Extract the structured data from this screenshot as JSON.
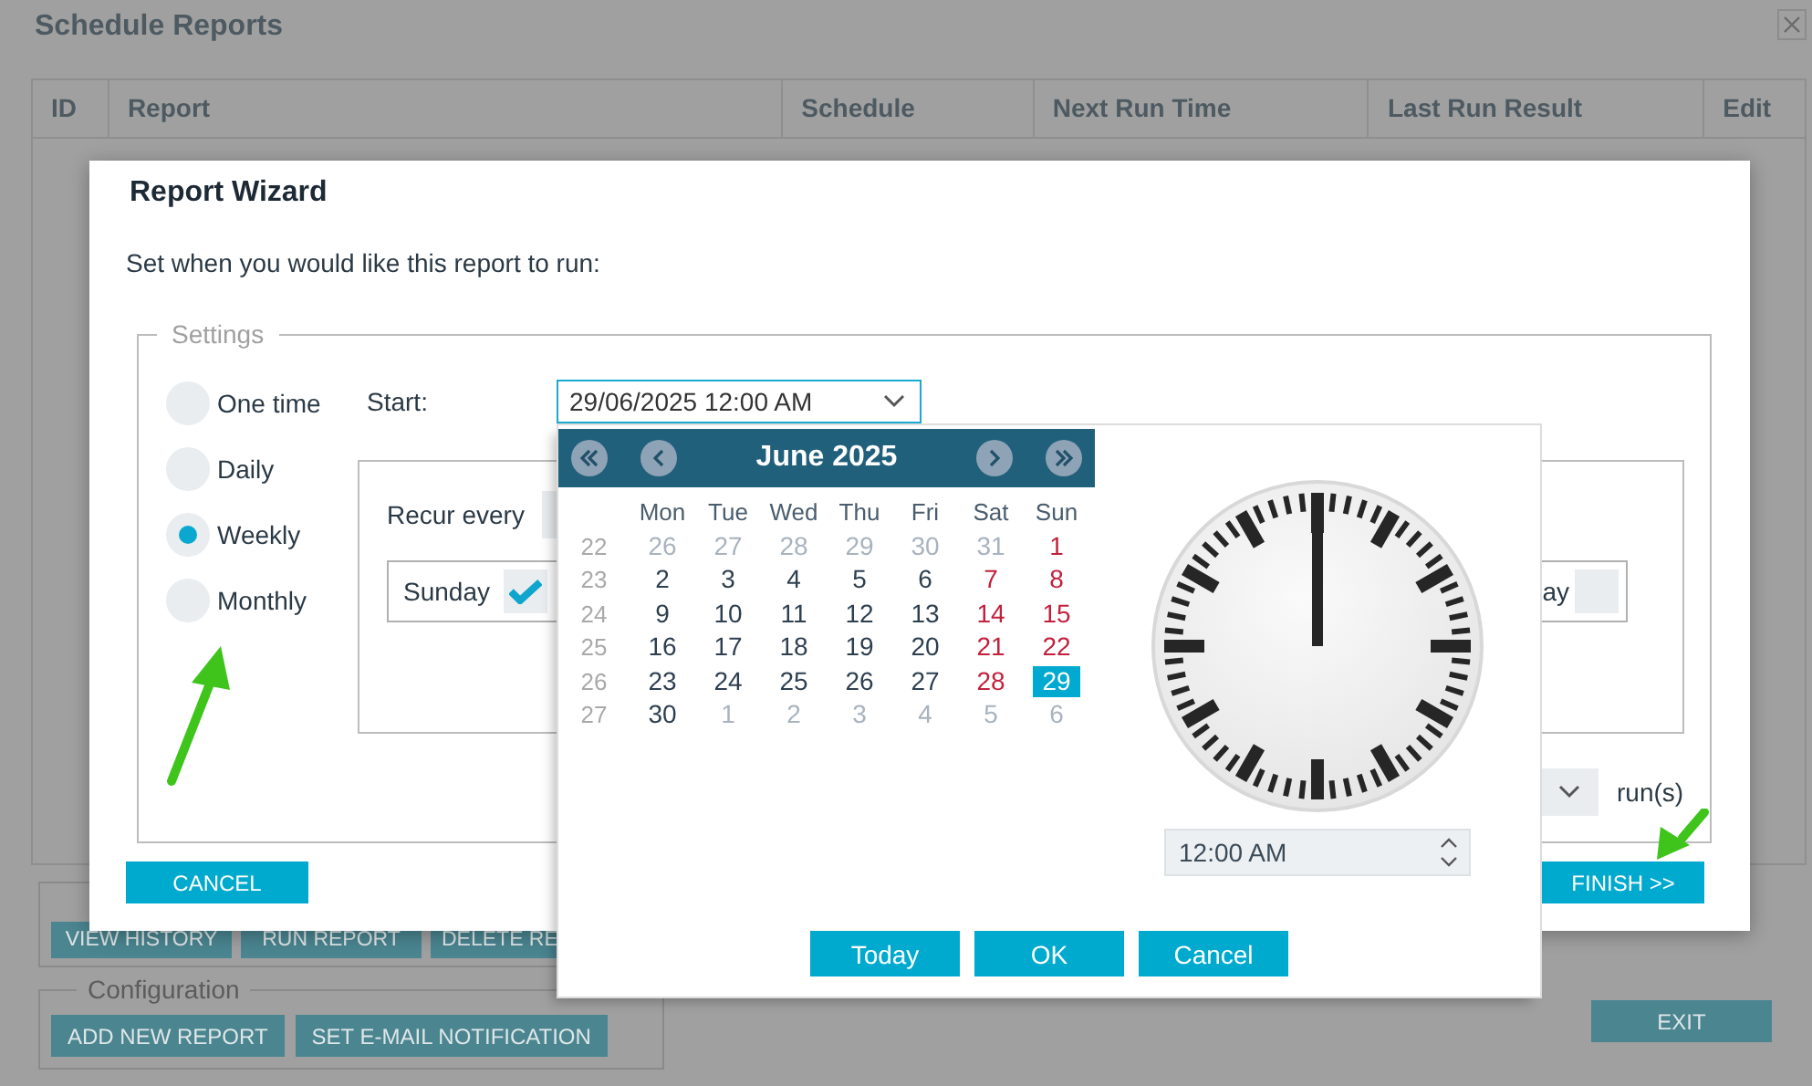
{
  "background": {
    "title": "Schedule Reports",
    "table": {
      "columns": [
        "ID",
        "Report",
        "Schedule",
        "Next Run Time",
        "Last Run Result",
        "Edit"
      ]
    },
    "operations": {
      "buttons": [
        "VIEW HISTORY",
        "RUN REPORT",
        "DELETE RE"
      ]
    },
    "configuration": {
      "legend": "Configuration",
      "buttons": [
        "ADD NEW REPORT",
        "SET E-MAIL NOTIFICATION"
      ]
    },
    "exit_button": "EXIT"
  },
  "wizard": {
    "title": "Report Wizard",
    "prompt": "Set when you would like this report to run:",
    "settings_legend": "Settings",
    "frequencies": [
      {
        "label": "One time",
        "selected": false
      },
      {
        "label": "Daily",
        "selected": false
      },
      {
        "label": "Weekly",
        "selected": true
      },
      {
        "label": "Monthly",
        "selected": false
      }
    ],
    "start_label": "Start:",
    "start_value": "29/06/2025 12:00 AM",
    "recur_label": "Recur every",
    "days": [
      {
        "label": "Sunday",
        "checked": true
      },
      {
        "label": "ay",
        "checked": false
      }
    ],
    "runs_label": "run(s)",
    "cancel_button": "CANCEL",
    "finish_button": "FINISH >>"
  },
  "date_picker": {
    "month": "June 2025",
    "weekdays": [
      "Mon",
      "Tue",
      "Wed",
      "Thu",
      "Fri",
      "Sat",
      "Sun"
    ],
    "weeks": [
      {
        "number": "22",
        "days": [
          {
            "day": "26",
            "kind": "other",
            "selected": false
          },
          {
            "day": "27",
            "kind": "other",
            "selected": false
          },
          {
            "day": "28",
            "kind": "other",
            "selected": false
          },
          {
            "day": "29",
            "kind": "other",
            "selected": false
          },
          {
            "day": "30",
            "kind": "other",
            "selected": false
          },
          {
            "day": "31",
            "kind": "other",
            "selected": false
          },
          {
            "day": "1",
            "kind": "weekend",
            "selected": false
          }
        ]
      },
      {
        "number": "23",
        "days": [
          {
            "day": "2",
            "kind": "normal",
            "selected": false
          },
          {
            "day": "3",
            "kind": "normal",
            "selected": false
          },
          {
            "day": "4",
            "kind": "normal",
            "selected": false
          },
          {
            "day": "5",
            "kind": "normal",
            "selected": false
          },
          {
            "day": "6",
            "kind": "normal",
            "selected": false
          },
          {
            "day": "7",
            "kind": "weekend",
            "selected": false
          },
          {
            "day": "8",
            "kind": "weekend",
            "selected": false
          }
        ]
      },
      {
        "number": "24",
        "days": [
          {
            "day": "9",
            "kind": "normal",
            "selected": false
          },
          {
            "day": "10",
            "kind": "normal",
            "selected": false
          },
          {
            "day": "11",
            "kind": "normal",
            "selected": false
          },
          {
            "day": "12",
            "kind": "normal",
            "selected": false
          },
          {
            "day": "13",
            "kind": "normal",
            "selected": false
          },
          {
            "day": "14",
            "kind": "weekend",
            "selected": false
          },
          {
            "day": "15",
            "kind": "weekend",
            "selected": false
          }
        ]
      },
      {
        "number": "25",
        "days": [
          {
            "day": "16",
            "kind": "normal",
            "selected": false
          },
          {
            "day": "17",
            "kind": "normal",
            "selected": false
          },
          {
            "day": "18",
            "kind": "normal",
            "selected": false
          },
          {
            "day": "19",
            "kind": "normal",
            "selected": false
          },
          {
            "day": "20",
            "kind": "normal",
            "selected": false
          },
          {
            "day": "21",
            "kind": "weekend",
            "selected": false
          },
          {
            "day": "22",
            "kind": "weekend",
            "selected": false
          }
        ]
      },
      {
        "number": "26",
        "days": [
          {
            "day": "23",
            "kind": "normal",
            "selected": false
          },
          {
            "day": "24",
            "kind": "normal",
            "selected": false
          },
          {
            "day": "25",
            "kind": "normal",
            "selected": false
          },
          {
            "day": "26",
            "kind": "normal",
            "selected": false
          },
          {
            "day": "27",
            "kind": "normal",
            "selected": false
          },
          {
            "day": "28",
            "kind": "weekend",
            "selected": false
          },
          {
            "day": "29",
            "kind": "weekend",
            "selected": true
          }
        ]
      },
      {
        "number": "27",
        "days": [
          {
            "day": "30",
            "kind": "normal",
            "selected": false
          },
          {
            "day": "1",
            "kind": "other",
            "selected": false
          },
          {
            "day": "2",
            "kind": "other",
            "selected": false
          },
          {
            "day": "3",
            "kind": "other",
            "selected": false
          },
          {
            "day": "4",
            "kind": "other",
            "selected": false
          },
          {
            "day": "5",
            "kind": "other",
            "selected": false
          },
          {
            "day": "6",
            "kind": "other",
            "selected": false
          }
        ]
      }
    ],
    "time": "12:00 AM",
    "buttons": [
      "Today",
      "OK",
      "Cancel"
    ]
  }
}
